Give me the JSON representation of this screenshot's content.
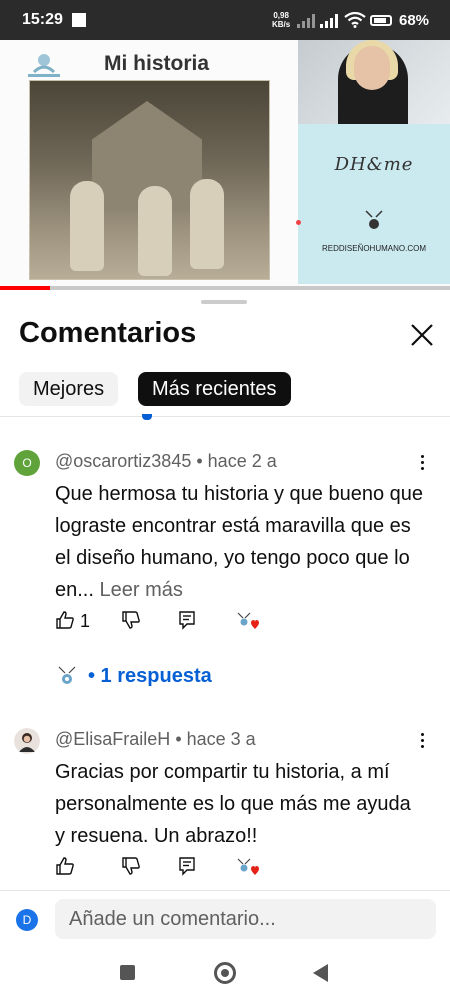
{
  "status_bar": {
    "time": "15:29",
    "net_speed_value": "0,98",
    "net_speed_unit": "KB/s",
    "battery": "68%"
  },
  "video": {
    "title": "Mi historia",
    "panel_text": "DH&me",
    "panel_site": "REDDISEÑOHUMANO.COM",
    "progress_fraction": 0.11,
    "accent_color": "#ff0000"
  },
  "comments_sheet": {
    "title": "Comentarios",
    "close_icon": "close-icon",
    "filters": [
      {
        "label": "Mejores",
        "selected": false
      },
      {
        "label": "Más recientes",
        "selected": true
      }
    ]
  },
  "comments": [
    {
      "avatar_letter": "O",
      "avatar_color": "#5fa33a",
      "author": "@oscarortiz3845",
      "time": "hace 2 a",
      "text": "Que hermosa tu historia y que bueno que lograste encontrar está maravilla que es el diseño humano, yo tengo poco que lo en...",
      "read_more": "Leer más",
      "likes": "1",
      "replies_label": "• 1 respuesta"
    },
    {
      "avatar_letter": "",
      "avatar_color": "#d9cfc8",
      "author": "@ElisaFraileH",
      "time": "hace 3 a",
      "text": "Gracias por compartir tu historia, a mí personalmente es lo que más me ayuda y resuena. Un abrazo!!",
      "likes": ""
    }
  ],
  "composer": {
    "avatar_letter": "D",
    "placeholder": "Añade un comentario..."
  },
  "colors": {
    "link_blue": "#065fd4",
    "heart_red": "#e62117"
  }
}
